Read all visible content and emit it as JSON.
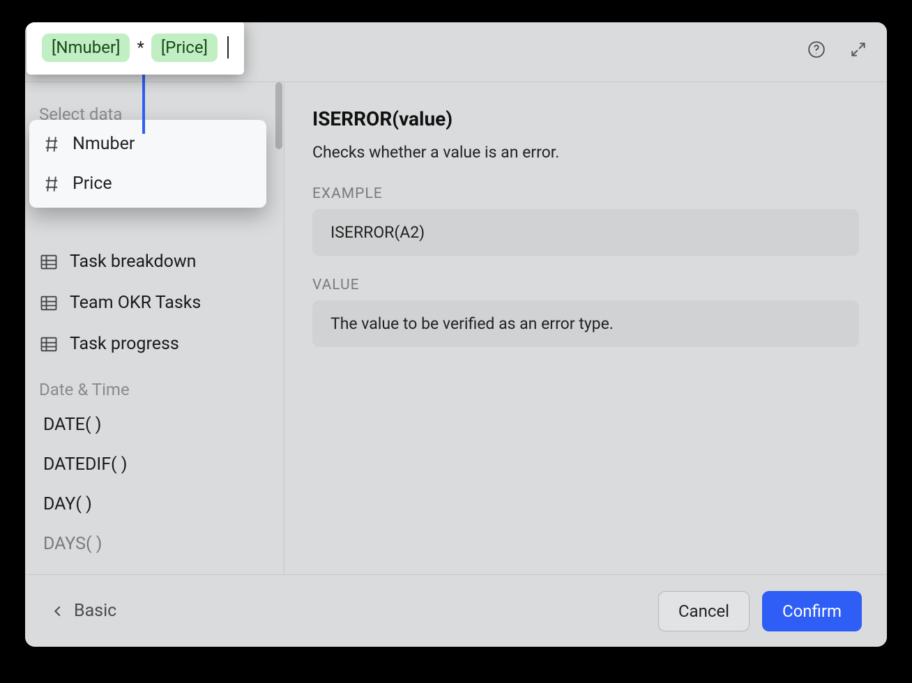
{
  "formula": {
    "token1": "[Nmuber]",
    "operator": "*",
    "token2": "[Price]"
  },
  "sidebar": {
    "select_label": "Select data",
    "dropdown": {
      "item1": "Nmuber",
      "item2": "Price"
    },
    "tables": {
      "item1": "Task breakdown",
      "item2": "Team OKR Tasks",
      "item3": "Task progress"
    },
    "group_datetime": "Date & Time",
    "functions": {
      "f1": "DATE( )",
      "f2": "DATEDIF( )",
      "f3": "DAY( )",
      "f4": "DAYS( )"
    }
  },
  "detail": {
    "title": "ISERROR(value)",
    "description": "Checks whether a value is an error.",
    "example_label": "EXAMPLE",
    "example_code": "ISERROR(A2)",
    "value_label": "VALUE",
    "value_desc": "The value to be verified as an error type."
  },
  "footer": {
    "back": "Basic",
    "cancel": "Cancel",
    "confirm": "Confirm"
  }
}
